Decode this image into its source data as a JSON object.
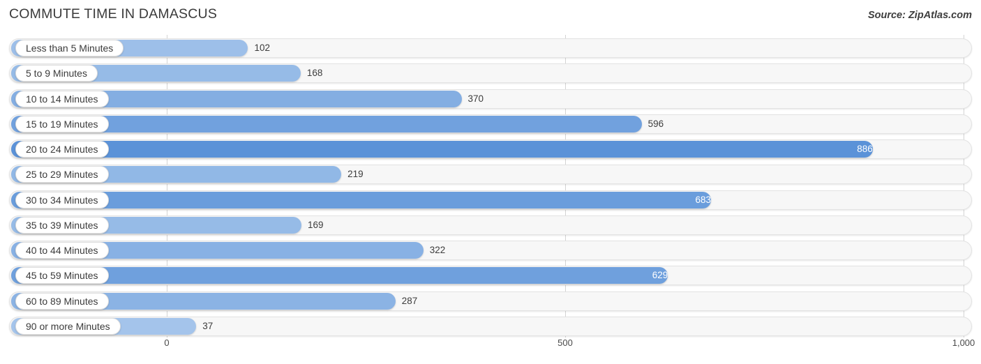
{
  "header": {
    "title": "COMMUTE TIME IN DAMASCUS",
    "source": "Source: ZipAtlas.com"
  },
  "colors": {
    "bar_light": "#a9c8ec",
    "bar_dark": "#5b92d8",
    "track": "#f7f7f7",
    "gridline": "#d4d4d4",
    "label_text": "#3b3b3b",
    "value_outside": "#3c3c3c",
    "value_inside": "#ffffff"
  },
  "chart_data": {
    "type": "bar",
    "orientation": "horizontal",
    "title": "COMMUTE TIME IN DAMASCUS",
    "subtitle": "",
    "xlabel": "",
    "ylabel": "",
    "xlim": [
      0,
      1000
    ],
    "ticks": [
      "0",
      "500",
      "1,000"
    ],
    "tick_values": [
      0,
      500,
      1000
    ],
    "grid": true,
    "legend": "none",
    "categories": [
      "Less than 5 Minutes",
      "5 to 9 Minutes",
      "10 to 14 Minutes",
      "15 to 19 Minutes",
      "20 to 24 Minutes",
      "25 to 29 Minutes",
      "30 to 34 Minutes",
      "35 to 39 Minutes",
      "40 to 44 Minutes",
      "45 to 59 Minutes",
      "60 to 89 Minutes",
      "90 or more Minutes"
    ],
    "values": [
      102,
      168,
      370,
      596,
      886,
      219,
      683,
      169,
      322,
      629,
      287,
      37
    ],
    "value_labels": [
      "102",
      "168",
      "370",
      "596",
      "886",
      "219",
      "683",
      "169",
      "322",
      "629",
      "287",
      "37"
    ],
    "label_placement": [
      "outside",
      "outside",
      "outside",
      "outside",
      "inside",
      "outside",
      "inside",
      "outside",
      "outside",
      "inside",
      "outside",
      "outside"
    ]
  }
}
